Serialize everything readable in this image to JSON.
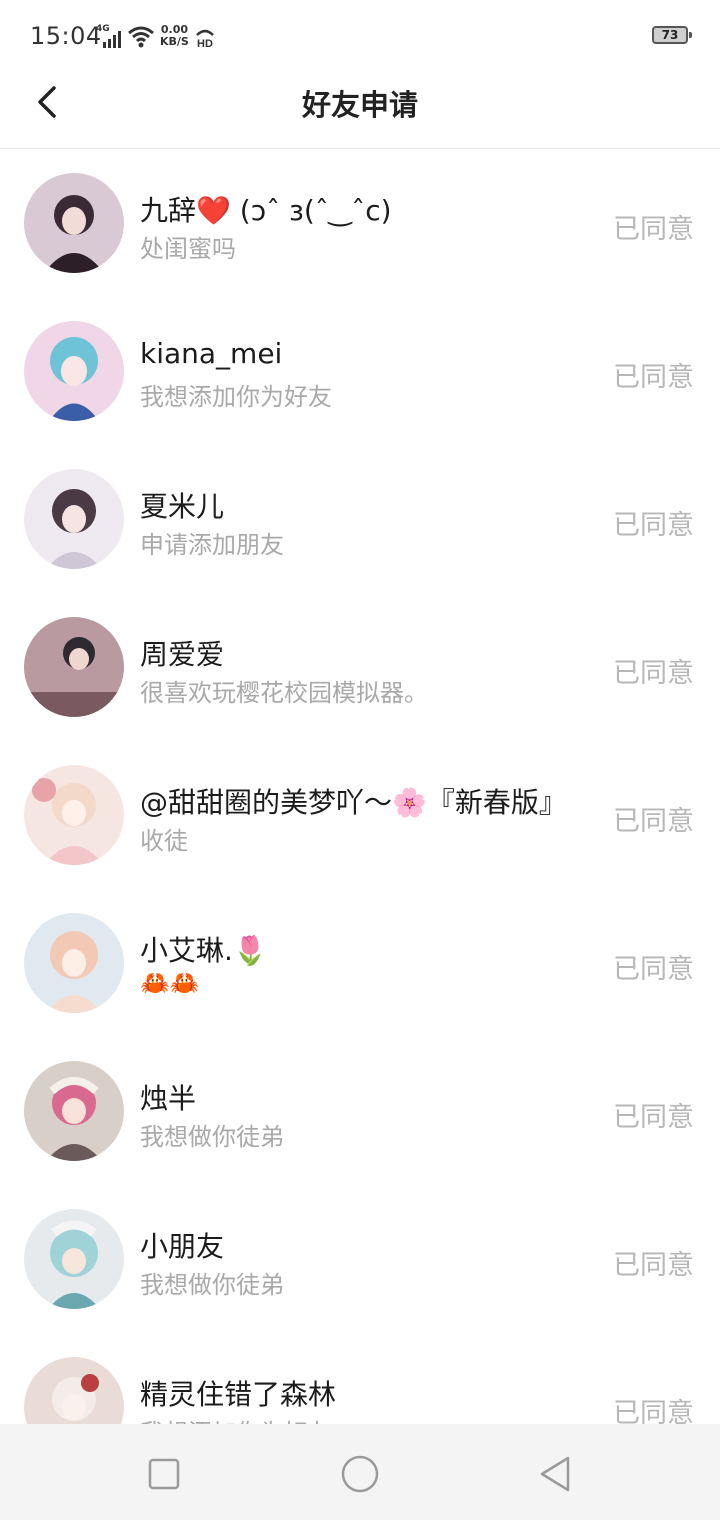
{
  "status_bar": {
    "time": "15:04",
    "network": "4G",
    "speed_top": "0.00",
    "speed_bottom": "KB/S",
    "hd": "HD",
    "battery": "73"
  },
  "header": {
    "title": "好友申请",
    "back_icon": "chevron-left-icon"
  },
  "requests": [
    {
      "name": "九辞❤️ (ɔˆ з(ˆ‿ˆc)",
      "message": "处闺蜜吗",
      "status": "已同意",
      "avatar_color": "#3a2a35"
    },
    {
      "name": "kiana_mei",
      "message": "我想添加你为好友",
      "status": "已同意",
      "avatar_color": "#6fc3d6"
    },
    {
      "name": "夏米儿",
      "message": "申请添加朋友",
      "status": "已同意",
      "avatar_color": "#cfc7d6"
    },
    {
      "name": "周爱爱",
      "message": "很喜欢玩樱花校园模拟器。",
      "status": "已同意",
      "avatar_color": "#7a5a60"
    },
    {
      "name": "@甜甜圈的美梦吖～🌸『新春版』",
      "message": "收徒",
      "status": "已同意",
      "avatar_color": "#f3c6c9"
    },
    {
      "name": "小艾琳.🌷",
      "message": "🦀🦀",
      "status": "已同意",
      "avatar_color": "#f2c9b5"
    },
    {
      "name": "烛半",
      "message": "我想做你徒弟",
      "status": "已同意",
      "avatar_color": "#d8cfc8"
    },
    {
      "name": "小朋友",
      "message": "我想做你徒弟",
      "status": "已同意",
      "avatar_color": "#9fd3d8"
    },
    {
      "name": "精灵住错了森林",
      "message": "我想添加你为好友",
      "status": "已同意",
      "avatar_color": "#e9dcd6"
    }
  ],
  "nav": {
    "recent_icon": "square-icon",
    "home_icon": "circle-icon",
    "back_icon": "triangle-back-icon"
  }
}
